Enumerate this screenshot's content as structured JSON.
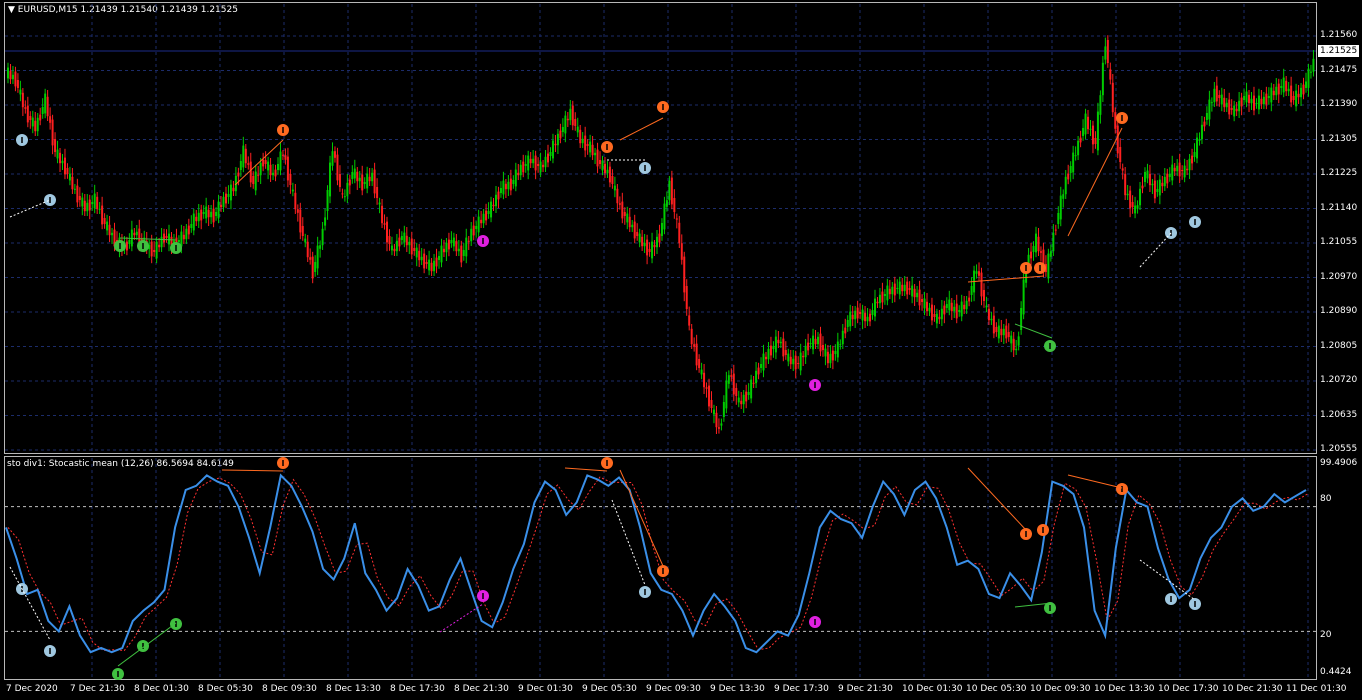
{
  "chart": {
    "title": "EURUSD,M15  1.21439 1.21540 1.21439 1.21525",
    "symbol": "EURUSD",
    "timeframe": "M15",
    "ohlc": {
      "open": "1.21439",
      "high": "1.21540",
      "low": "1.21439",
      "close": "1.21525"
    },
    "current_price": "1.21525",
    "price_ticks": [
      "1.21560",
      "1.21475",
      "1.21390",
      "1.21305",
      "1.21225",
      "1.21140",
      "1.21055",
      "1.20970",
      "1.20890",
      "1.20805",
      "1.20720",
      "1.20635",
      "1.20555"
    ],
    "colors": {
      "bull": "#00cc00",
      "bear": "#ff2020",
      "grid": "#1c2c6a",
      "price_line": "#1c2c8a",
      "background": "#000000"
    }
  },
  "indicator": {
    "title": "sto div1: Stocastic mean  (12,26) 86.5694 84.6149",
    "levels": [
      "99.4906",
      "80",
      "20",
      "0.4424"
    ],
    "colors": {
      "main": "#3a8fe8",
      "signal": "#ff3030",
      "level": "#c0c0c0"
    }
  },
  "time_axis": [
    "7 Dec 2020",
    "7 Dec 21:30",
    "8 Dec 01:30",
    "8 Dec 05:30",
    "8 Dec 09:30",
    "8 Dec 13:30",
    "8 Dec 17:30",
    "8 Dec 21:30",
    "9 Dec 01:30",
    "9 Dec 05:30",
    "9 Dec 09:30",
    "9 Dec 13:30",
    "9 Dec 17:30",
    "9 Dec 21:30",
    "10 Dec 01:30",
    "10 Dec 05:30",
    "10 Dec 09:30",
    "10 Dec 13:30",
    "10 Dec 17:30",
    "10 Dec 21:30",
    "11 Dec 01:30"
  ],
  "chart_data": {
    "type": "candlestick",
    "price_range": [
      1.20555,
      1.2159
    ],
    "close_path": [
      1.2148,
      1.214,
      1.2136,
      1.2143,
      1.213,
      1.2126,
      1.212,
      1.2116,
      1.2118,
      1.2112,
      1.2108,
      1.2106,
      1.211,
      1.2107,
      1.2105,
      1.2109,
      1.2107,
      1.2109,
      1.2113,
      1.2115,
      1.2114,
      1.2118,
      1.2121,
      1.213,
      1.2122,
      1.2128,
      1.2124,
      1.213,
      1.2119,
      1.2109,
      1.21,
      1.211,
      1.2131,
      1.2118,
      1.2125,
      1.2122,
      1.2124,
      1.2113,
      1.2105,
      1.2109,
      1.2106,
      1.2103,
      1.2101,
      1.2105,
      1.2108,
      1.2104,
      1.211,
      1.2113,
      1.2116,
      1.2121,
      1.2122,
      1.2126,
      1.2128,
      1.2126,
      1.213,
      1.2135,
      1.214,
      1.2133,
      1.2131,
      1.2127,
      1.2124,
      1.2116,
      1.2112,
      1.2108,
      1.2105,
      1.2109,
      1.2122,
      1.2108,
      1.2085,
      1.2076,
      1.2068,
      1.206,
      1.2075,
      1.2067,
      1.207,
      1.2076,
      1.208,
      1.2083,
      1.2078,
      1.2077,
      1.2082,
      1.2083,
      1.2078,
      1.2081,
      1.2088,
      1.209,
      1.2088,
      1.2093,
      1.2095,
      1.2096,
      1.2096,
      1.2094,
      1.2091,
      1.2088,
      1.2092,
      1.209,
      1.2092,
      1.2101,
      1.209,
      1.2085,
      1.2085,
      1.208,
      1.2102,
      1.2108,
      1.21,
      1.2112,
      1.2123,
      1.213,
      1.2138,
      1.2132,
      1.2158,
      1.2135,
      1.212,
      1.2115,
      1.2125,
      1.212,
      1.2123,
      1.2126,
      1.2125,
      1.213,
      1.2138,
      1.2145,
      1.2142,
      1.214,
      1.2144,
      1.2142,
      1.2143,
      1.2145,
      1.2147,
      1.2143,
      1.2146,
      1.21525
    ],
    "indicator_main": [
      70,
      55,
      38,
      40,
      25,
      20,
      32,
      18,
      10,
      12,
      10,
      12,
      25,
      30,
      34,
      40,
      70,
      88,
      90,
      95,
      92,
      90,
      80,
      65,
      48,
      70,
      95,
      90,
      80,
      68,
      50,
      45,
      55,
      72,
      48,
      40,
      30,
      36,
      50,
      42,
      30,
      32,
      45,
      55,
      40,
      25,
      22,
      34,
      50,
      62,
      82,
      92,
      88,
      76,
      82,
      95,
      93,
      90,
      94,
      88,
      70,
      48,
      40,
      38,
      30,
      18,
      30,
      38,
      32,
      25,
      12,
      10,
      15,
      20,
      18,
      28,
      48,
      70,
      78,
      74,
      72,
      65,
      80,
      92,
      86,
      76,
      88,
      92,
      84,
      70,
      52,
      54,
      50,
      38,
      36,
      48,
      42,
      35,
      58,
      92,
      90,
      86,
      70,
      30,
      18,
      60,
      88,
      82,
      80,
      60,
      45,
      36,
      40,
      55,
      65,
      70,
      80,
      84,
      78,
      80,
      86,
      82,
      85,
      88
    ]
  }
}
